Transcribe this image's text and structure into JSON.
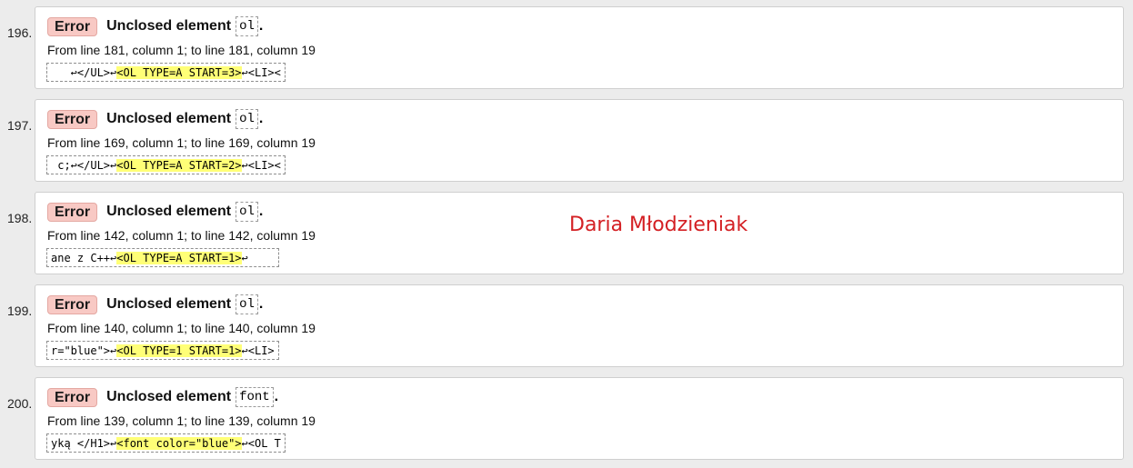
{
  "messages": [
    {
      "number": "196.",
      "type": "Error",
      "title": "Unclosed element",
      "element": "ol",
      "period": ".",
      "location": "From line 181, column 1; to line 181, column 19",
      "extract": {
        "before": "   ↩</UL>↩",
        "highlight": "<OL TYPE=A START=3>",
        "after": "↩<LI><"
      }
    },
    {
      "number": "197.",
      "type": "Error",
      "title": "Unclosed element",
      "element": "ol",
      "period": ".",
      "location": "From line 169, column 1; to line 169, column 19",
      "extract": {
        "before": " c;↩</UL>↩",
        "highlight": "<OL TYPE=A START=2>",
        "after": "↩<LI><"
      }
    },
    {
      "number": "198.",
      "type": "Error",
      "title": "Unclosed element",
      "element": "ol",
      "period": ".",
      "location": "From line 142, column 1; to line 142, column 19",
      "extract": {
        "before": "ane z C++↩",
        "highlight": "<OL TYPE=A START=1>",
        "after": "↩    "
      }
    },
    {
      "number": "199.",
      "type": "Error",
      "title": "Unclosed element",
      "element": "ol",
      "period": ".",
      "location": "From line 140, column 1; to line 140, column 19",
      "extract": {
        "before": "r=\"blue\">↩",
        "highlight": "<OL TYPE=1 START=1>",
        "after": "↩<LI>"
      }
    },
    {
      "number": "200.",
      "type": "Error",
      "title": "Unclosed element",
      "element": "font",
      "period": ".",
      "location": "From line 139, column 1; to line 139, column 19",
      "extract": {
        "before": "yką </H1>↩",
        "highlight": "<font color=\"blue\">",
        "after": "↩<OL T"
      }
    }
  ],
  "watermark": "Daria Młodzieniak",
  "colors": {
    "background": "#ececec",
    "badge_error": "#f8c9c4",
    "highlight": "#ffff77",
    "watermark": "#d42024"
  }
}
